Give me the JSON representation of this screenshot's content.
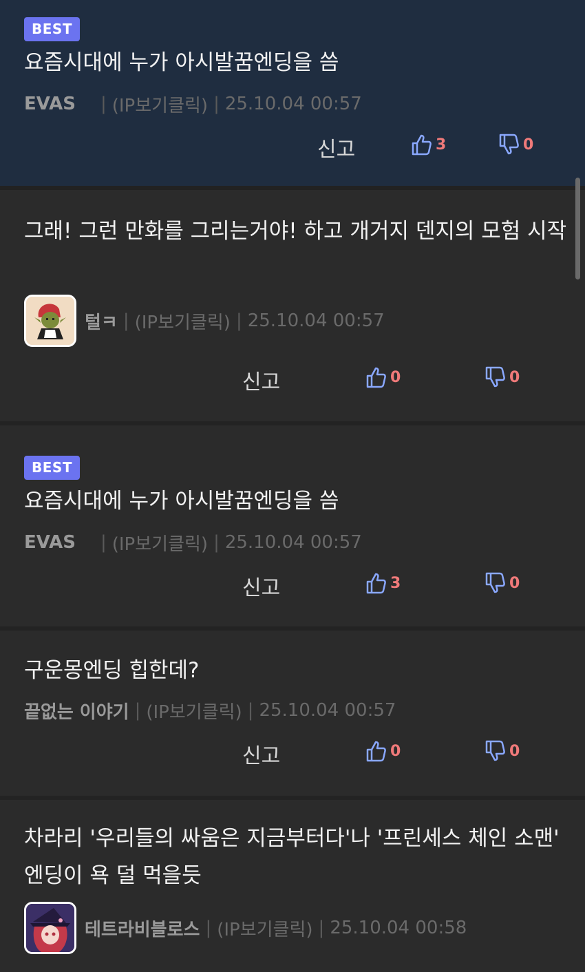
{
  "comments": [
    {
      "badge": "BEST",
      "text": "요즘시대에 누가 아시발꿈엔딩을 씀",
      "author": "EVAS",
      "ip": "(IP보기클릭)",
      "date": "25.10.04 00:57",
      "report": "신고",
      "likes": "3",
      "dislikes": "0"
    },
    {
      "text": "그래! 그런 만화를 그리는거야! 하고 개거지 덴지의 모험 시작",
      "author": "털ㅋ",
      "ip": "(IP보기클릭)",
      "date": "25.10.04 00:57",
      "report": "신고",
      "likes": "0",
      "dislikes": "0"
    },
    {
      "badge": "BEST",
      "text": "요즘시대에 누가 아시발꿈엔딩을 씀",
      "author": "EVAS",
      "ip": "(IP보기클릭)",
      "date": "25.10.04 00:57",
      "report": "신고",
      "likes": "3",
      "dislikes": "0"
    },
    {
      "text": "구운몽엔딩 힙한데?",
      "author": "끝없는 이야기",
      "ip": "(IP보기클릭)",
      "date": "25.10.04 00:57",
      "report": "신고",
      "likes": "0",
      "dislikes": "0"
    },
    {
      "text": "차라리 '우리들의 싸움은 지금부터다'나 '프린세스 체인 소맨' 엔딩이 욕 덜 먹을듯",
      "author": "테트라비블로스",
      "ip": "(IP보기클릭)",
      "date": "25.10.04 00:58"
    }
  ],
  "separator": "|",
  "icons": {
    "like": "thumbs-up-icon",
    "dislike": "thumbs-down-icon"
  },
  "colors": {
    "badge": "#6b73f0",
    "best_background": "#1f2d40",
    "background": "#2b2b2b",
    "vote_icon": "#8aa8ff",
    "vote_count": "#f07a7a"
  }
}
